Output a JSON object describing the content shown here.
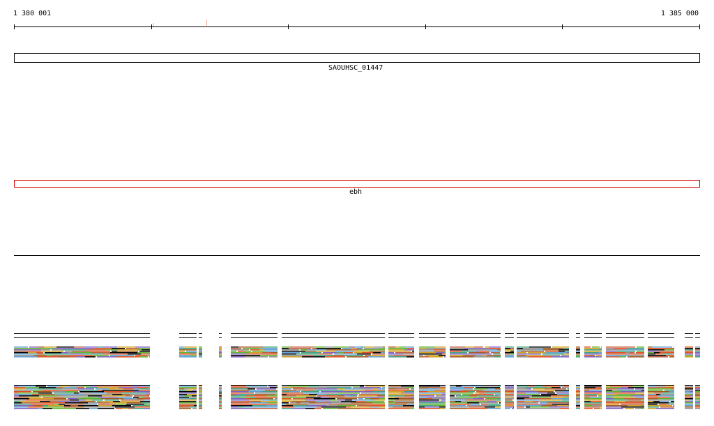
{
  "ruler": {
    "start_label": "1 380 001",
    "end_label": "1 385 000"
  },
  "genes": [
    {
      "name": "SAOUHSC_01447",
      "color": "#000000"
    },
    {
      "name": "ebh",
      "color": "#d00000"
    }
  ],
  "colors": {
    "axis": "#000000",
    "highlight_gene": "#d00000",
    "marker": "#f4b0a0",
    "alignment_palette": [
      "#000000",
      "#e05020",
      "#d0a020",
      "#60b030",
      "#8060c0",
      "#60a0d0",
      "#c06040",
      "#909090",
      "#a05a20",
      "#40a080"
    ]
  }
}
